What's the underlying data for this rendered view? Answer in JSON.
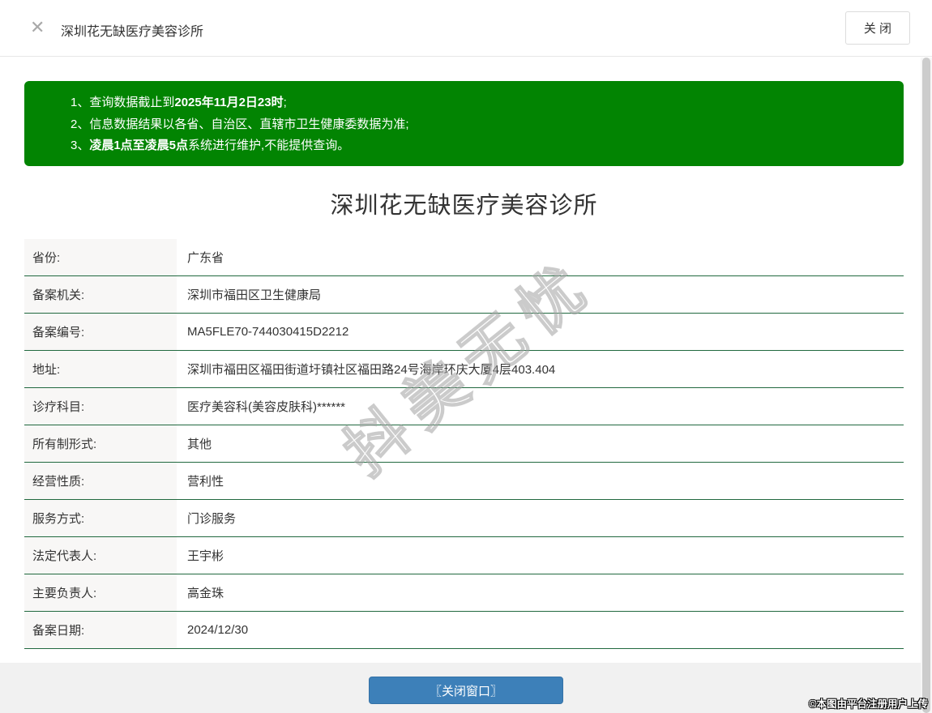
{
  "header": {
    "title": "深圳花无缺医疗美容诊所",
    "close_button": "关 闭",
    "close_icon": "✕"
  },
  "notice": {
    "items": [
      {
        "num": "1、",
        "pre": "查询数据截止到",
        "bold": "2025年11月2日23时",
        "post": ";"
      },
      {
        "num": "2、",
        "pre": "信息数据结果以各省、自治区、直辖市卫生健康委数据为准;",
        "bold": "",
        "post": ""
      },
      {
        "num": "3、",
        "pre": "",
        "bold": "凌晨1点至凌晨5点",
        "post": "系统进行维护,不能提供查询。"
      }
    ]
  },
  "main": {
    "title": "深圳花无缺医疗美容诊所"
  },
  "table": {
    "rows": [
      {
        "label": "省份:",
        "value": "广东省"
      },
      {
        "label": "备案机关:",
        "value": "深圳市福田区卫生健康局"
      },
      {
        "label": "备案编号:",
        "value": "MA5FLE70-744030415D2212"
      },
      {
        "label": "地址:",
        "value": "深圳市福田区福田街道圩镇社区福田路24号海岸环庆大厦4层403.404"
      },
      {
        "label": "诊疗科目:",
        "value": "医疗美容科(美容皮肤科)******"
      },
      {
        "label": "所有制形式:",
        "value": "其他"
      },
      {
        "label": "经营性质:",
        "value": "营利性"
      },
      {
        "label": "服务方式:",
        "value": "门诊服务"
      },
      {
        "label": "法定代表人:",
        "value": "王宇彬"
      },
      {
        "label": "主要负责人:",
        "value": "高金珠"
      },
      {
        "label": "备案日期:",
        "value": "2024/12/30"
      }
    ]
  },
  "footer": {
    "close_window_button": "〖关闭窗口〗"
  },
  "watermark": {
    "text": "抖美无忧"
  },
  "credit": {
    "text": "©本图由平台注册用户上传"
  },
  "colors": {
    "notice_green": "#028402",
    "row_divider_green": "#21693f",
    "button_blue": "#3d80b9"
  }
}
